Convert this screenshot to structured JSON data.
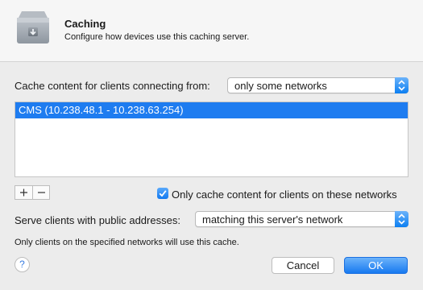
{
  "header": {
    "icon": "caching-server-icon",
    "title": "Caching",
    "subtitle": "Configure how devices use this caching server."
  },
  "cache_from": {
    "label": "Cache content for clients connecting from:",
    "selected": "only some networks"
  },
  "networks": {
    "items": [
      {
        "label": "CMS (10.238.48.1 - 10.238.63.254)",
        "selected": true
      }
    ]
  },
  "list_controls": {
    "add_icon": "plus-icon",
    "remove_icon": "minus-icon"
  },
  "only_cache_checkbox": {
    "label": "Only cache content for clients on these networks",
    "checked": true
  },
  "public_clients": {
    "label": "Serve clients with public addresses:",
    "selected": "matching this server's network"
  },
  "note": "Only clients on the specified networks will use this cache.",
  "help_icon": "question-mark-icon",
  "buttons": {
    "cancel": "Cancel",
    "ok": "OK"
  },
  "colors": {
    "accent": "#1e7cf0",
    "window_bg": "#ececec",
    "header_bg": "#f6f6f6"
  }
}
